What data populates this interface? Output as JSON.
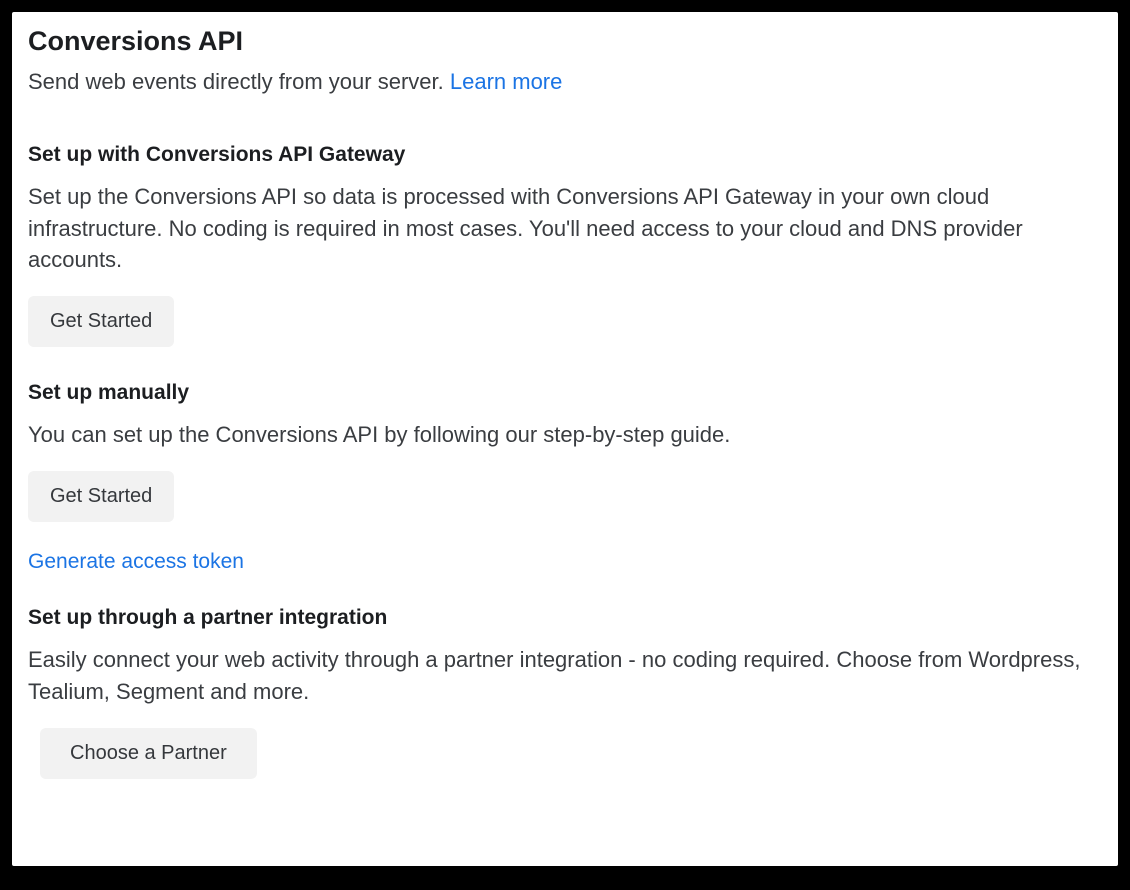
{
  "header": {
    "title": "Conversions API",
    "intro_text": "Send web events directly from your server. ",
    "learn_more_label": "Learn more"
  },
  "sections": {
    "gateway": {
      "heading": "Set up with Conversions API Gateway",
      "description": "Set up the Conversions API so data is processed with Conversions API Gateway in your own cloud infrastructure. No coding is required in most cases. You'll need access to your cloud and DNS provider accounts.",
      "button_label": "Get Started"
    },
    "manual": {
      "heading": "Set up manually",
      "description": "You can set up the Conversions API by following our step-by-step guide.",
      "button_label": "Get Started",
      "token_link_label": "Generate access token"
    },
    "partner": {
      "heading": "Set up through a partner integration",
      "description": "Easily connect your web activity through a partner integration - no coding required. Choose from Wordpress, Tealium, Segment and more.",
      "button_label": "Choose a Partner"
    }
  }
}
